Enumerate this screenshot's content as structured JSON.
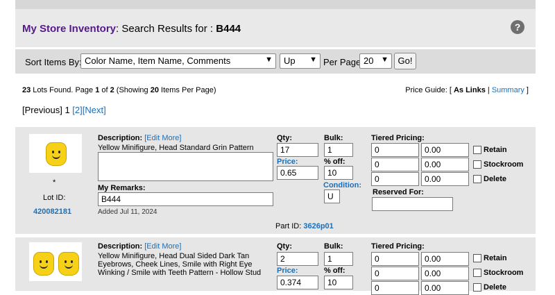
{
  "header": {
    "store_name": "My Store Inventory",
    "results_prefix": ": Search Results for : ",
    "query": "B444",
    "help_icon": "?"
  },
  "sortbar": {
    "sort_label": "Sort Items By:",
    "sort_value": "Color Name, Item Name, Comments",
    "direction_value": "Up",
    "per_page_label": "Per Page:",
    "per_page_value": "20",
    "go_label": "Go!"
  },
  "summary": {
    "lots_count": "23",
    "lots_text": " Lots Found. Page ",
    "page": "1",
    "of_text": " of ",
    "pages": "2",
    "showing_text": " (Showing ",
    "per_page": "20",
    "items_text": " Items Per Page)",
    "price_guide_label": "Price Guide: [ ",
    "as_links": "As Links",
    "sep": " | ",
    "summary_link": "Summary",
    "close": " ]"
  },
  "pager": {
    "previous": "[Previous]",
    "current": "1",
    "page2": "[2]",
    "next": "[Next]"
  },
  "lots": [
    {
      "desc_label": "Description:",
      "edit_more": "[Edit More]",
      "description": "Yellow Minifigure, Head Standard Grin Pattern",
      "remarks_label": "My Remarks:",
      "remarks": "B444",
      "added": "Added Jul 11, 2024",
      "star": "*",
      "lot_label": "Lot ID:",
      "lot_id": "420082181",
      "qty_label": "Qty:",
      "qty": "17",
      "price_label": "Price:",
      "price": "0.65",
      "bulk_label": "Bulk:",
      "bulk": "1",
      "off_label": "% off:",
      "off": "10",
      "condition_label": "Condition:",
      "condition": "U",
      "tiered_label": "Tiered Pricing:",
      "tiers": [
        [
          "0",
          "0.00"
        ],
        [
          "0",
          "0.00"
        ],
        [
          "0",
          "0.00"
        ]
      ],
      "retain": "Retain",
      "stockroom": "Stockroom",
      "delete": "Delete",
      "reserved_label": "Reserved For:",
      "part_id_label": "Part ID:",
      "part_id": "3626p01"
    },
    {
      "desc_label": "Description:",
      "edit_more": "[Edit More]",
      "description": "Yellow Minifigure, Head Dual Sided Dark Tan Eyebrows, Cheek Lines, Smile with Right Eye Winking / Smile with Teeth Pattern - Hollow Stud",
      "qty_label": "Qty:",
      "qty": "2",
      "price_label": "Price:",
      "price": "0.374",
      "bulk_label": "Bulk:",
      "bulk": "1",
      "off_label": "% off:",
      "off": "10",
      "tiered_label": "Tiered Pricing:",
      "tiers": [
        [
          "0",
          "0.00"
        ],
        [
          "0",
          "0.00"
        ],
        [
          "0",
          "0.00"
        ]
      ],
      "retain": "Retain",
      "stockroom": "Stockroom",
      "delete": "Delete"
    }
  ]
}
